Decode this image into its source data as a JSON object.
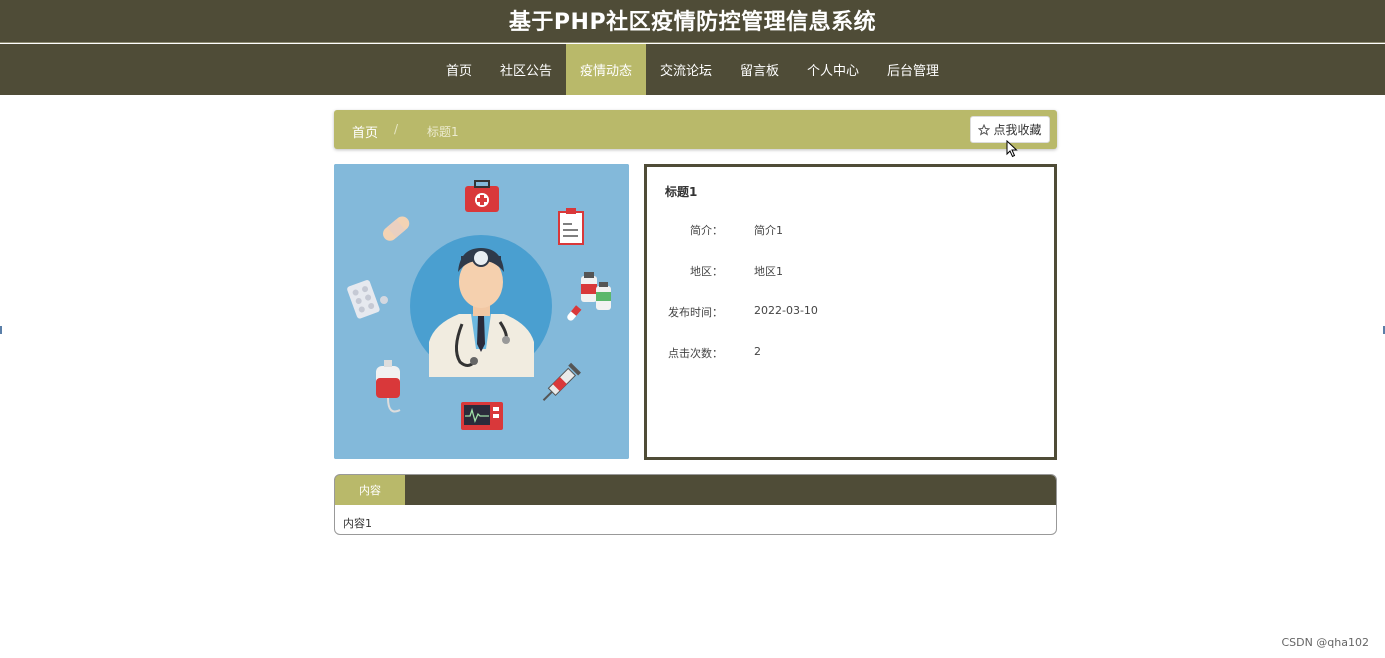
{
  "header": {
    "title": "基于PHP社区疫情防控管理信息系统"
  },
  "nav": {
    "items": [
      {
        "label": "首页"
      },
      {
        "label": "社区公告"
      },
      {
        "label": "疫情动态",
        "active": true
      },
      {
        "label": "交流论坛"
      },
      {
        "label": "留言板"
      },
      {
        "label": "个人中心"
      },
      {
        "label": "后台管理"
      }
    ]
  },
  "breadcrumb": {
    "home": "首页",
    "separator": "/",
    "current": "标题1"
  },
  "favorite": {
    "label": "点我收藏",
    "icon": "star-outline-icon"
  },
  "detail": {
    "title": "标题1",
    "rows": [
      {
        "label": "简介：",
        "value": "简介1"
      },
      {
        "label": "地区：",
        "value": "地区1"
      },
      {
        "label": "发布时间：",
        "value": "2022-03-10"
      },
      {
        "label": "点击次数：",
        "value": "2"
      }
    ]
  },
  "content": {
    "tab_label": "内容",
    "text": "内容1"
  },
  "watermark": "CSDN @qha102",
  "colors": {
    "dark_olive": "#4f4c37",
    "accent_olive": "#b9b96a",
    "image_bg": "#83b9da"
  }
}
